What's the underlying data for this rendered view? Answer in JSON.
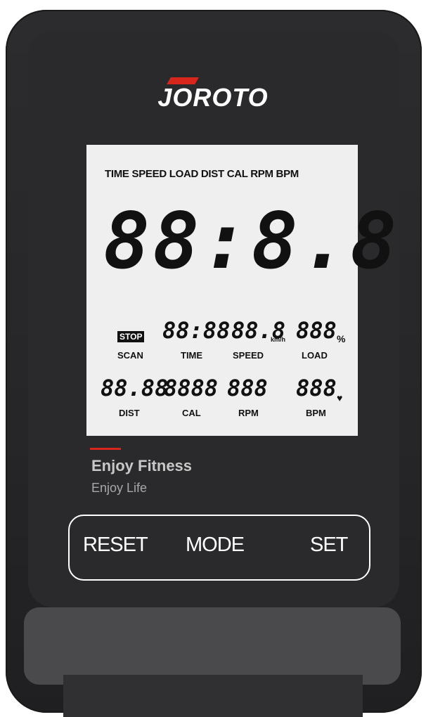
{
  "brand": {
    "logo_text": "JOROTO",
    "accent_color": "#d9261c"
  },
  "lcd": {
    "top_labels": "TIME SPEED LOAD DIST CAL RPM BPM",
    "main_digits": "88:8.8",
    "stop_badge": "STOP",
    "row1": {
      "scan_label": "SCAN",
      "time_digits": "88:88",
      "time_label": "TIME",
      "speed_digits": "88.8",
      "speed_unit": "km/h",
      "speed_label": "SPEED",
      "load_digits": "888",
      "load_unit": "%",
      "load_label": "LOAD"
    },
    "row2": {
      "dist_digits": "88.88",
      "dist_label": "DIST",
      "cal_digits": "8888",
      "cal_label": "CAL",
      "rpm_digits": "888",
      "rpm_label": "RPM",
      "bpm_digits": "888",
      "bpm_icon": "♥",
      "bpm_label": "BPM"
    }
  },
  "tagline": {
    "line1": "Enjoy Fitness",
    "line2": "Enjoy Life"
  },
  "buttons": {
    "reset": "RESET",
    "mode": "MODE",
    "set": "SET"
  }
}
